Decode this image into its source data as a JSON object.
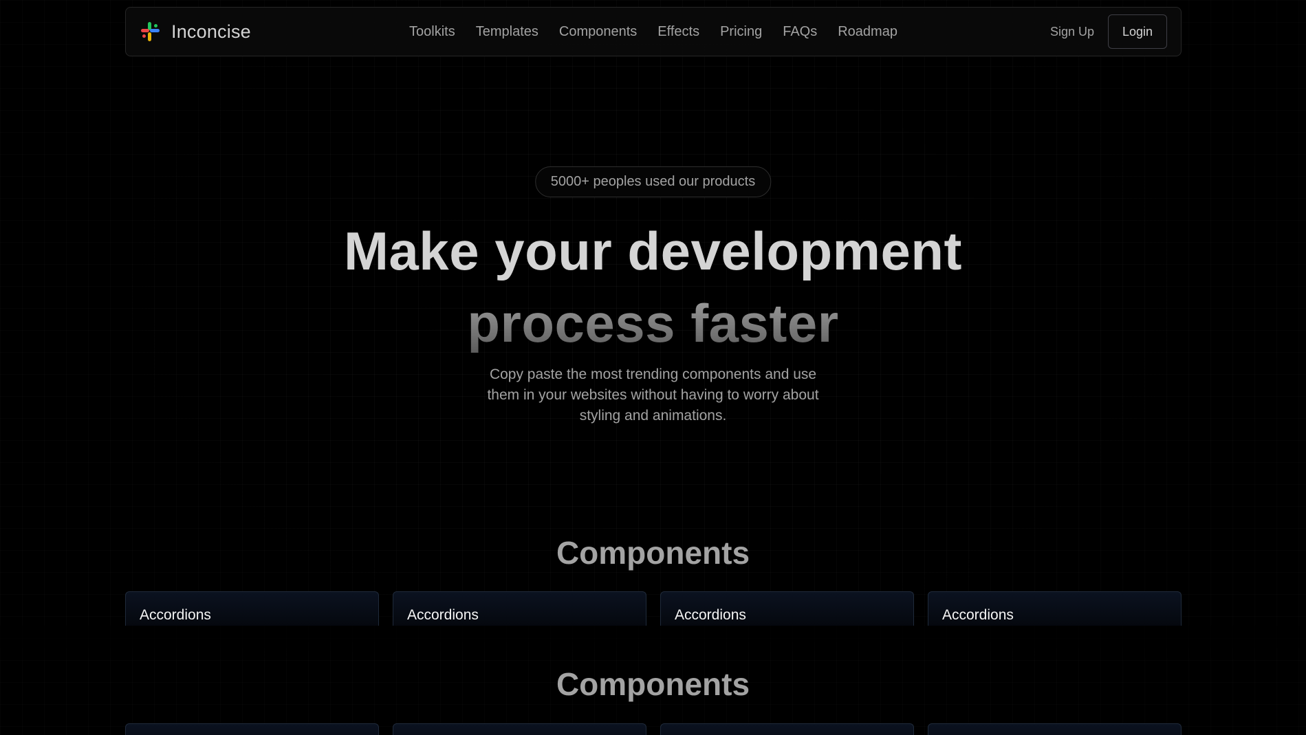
{
  "nav": {
    "brand": "Inconcise",
    "links": [
      "Toolkits",
      "Templates",
      "Components",
      "Effects",
      "Pricing",
      "FAQs",
      "Roadmap"
    ],
    "signup": "Sign Up",
    "login": "Login"
  },
  "hero": {
    "badge": "5000+ peoples used our products",
    "title_line1": "Make your development",
    "title_line2": "process faster",
    "subtitle": "Copy paste the most trending components and use them in your websites without having to worry about styling and animations."
  },
  "sections": [
    {
      "title": "Components",
      "cards": [
        "Accordions",
        "Accordions",
        "Accordions",
        "Accordions"
      ]
    },
    {
      "title": "Components",
      "cards": [
        "",
        "",
        "",
        ""
      ]
    }
  ],
  "colors": {
    "background": "#000000",
    "logo_red": "#ef4444",
    "logo_green": "#22c55e",
    "logo_blue": "#3b82f6",
    "logo_yellow": "#eab308"
  }
}
